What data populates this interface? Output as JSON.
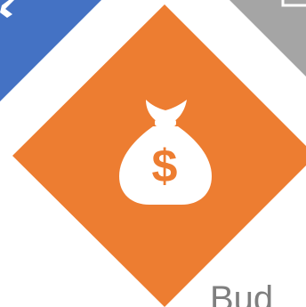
{
  "colors": {
    "background": "#ffffff",
    "blue_tile": "#4472c4",
    "orange_tile": "#ed7d31",
    "gray_tile": "#a5a5a5",
    "icon_fill": "#ffffff",
    "text_gray": "#7f7f7f"
  },
  "tiles": {
    "blue": {
      "icon": "partial-icon"
    },
    "orange": {
      "icon": "money-bag-icon",
      "symbol": "$"
    },
    "gray": {
      "icon": "partial-outline-icon"
    }
  },
  "caption": {
    "text": "Bud"
  }
}
